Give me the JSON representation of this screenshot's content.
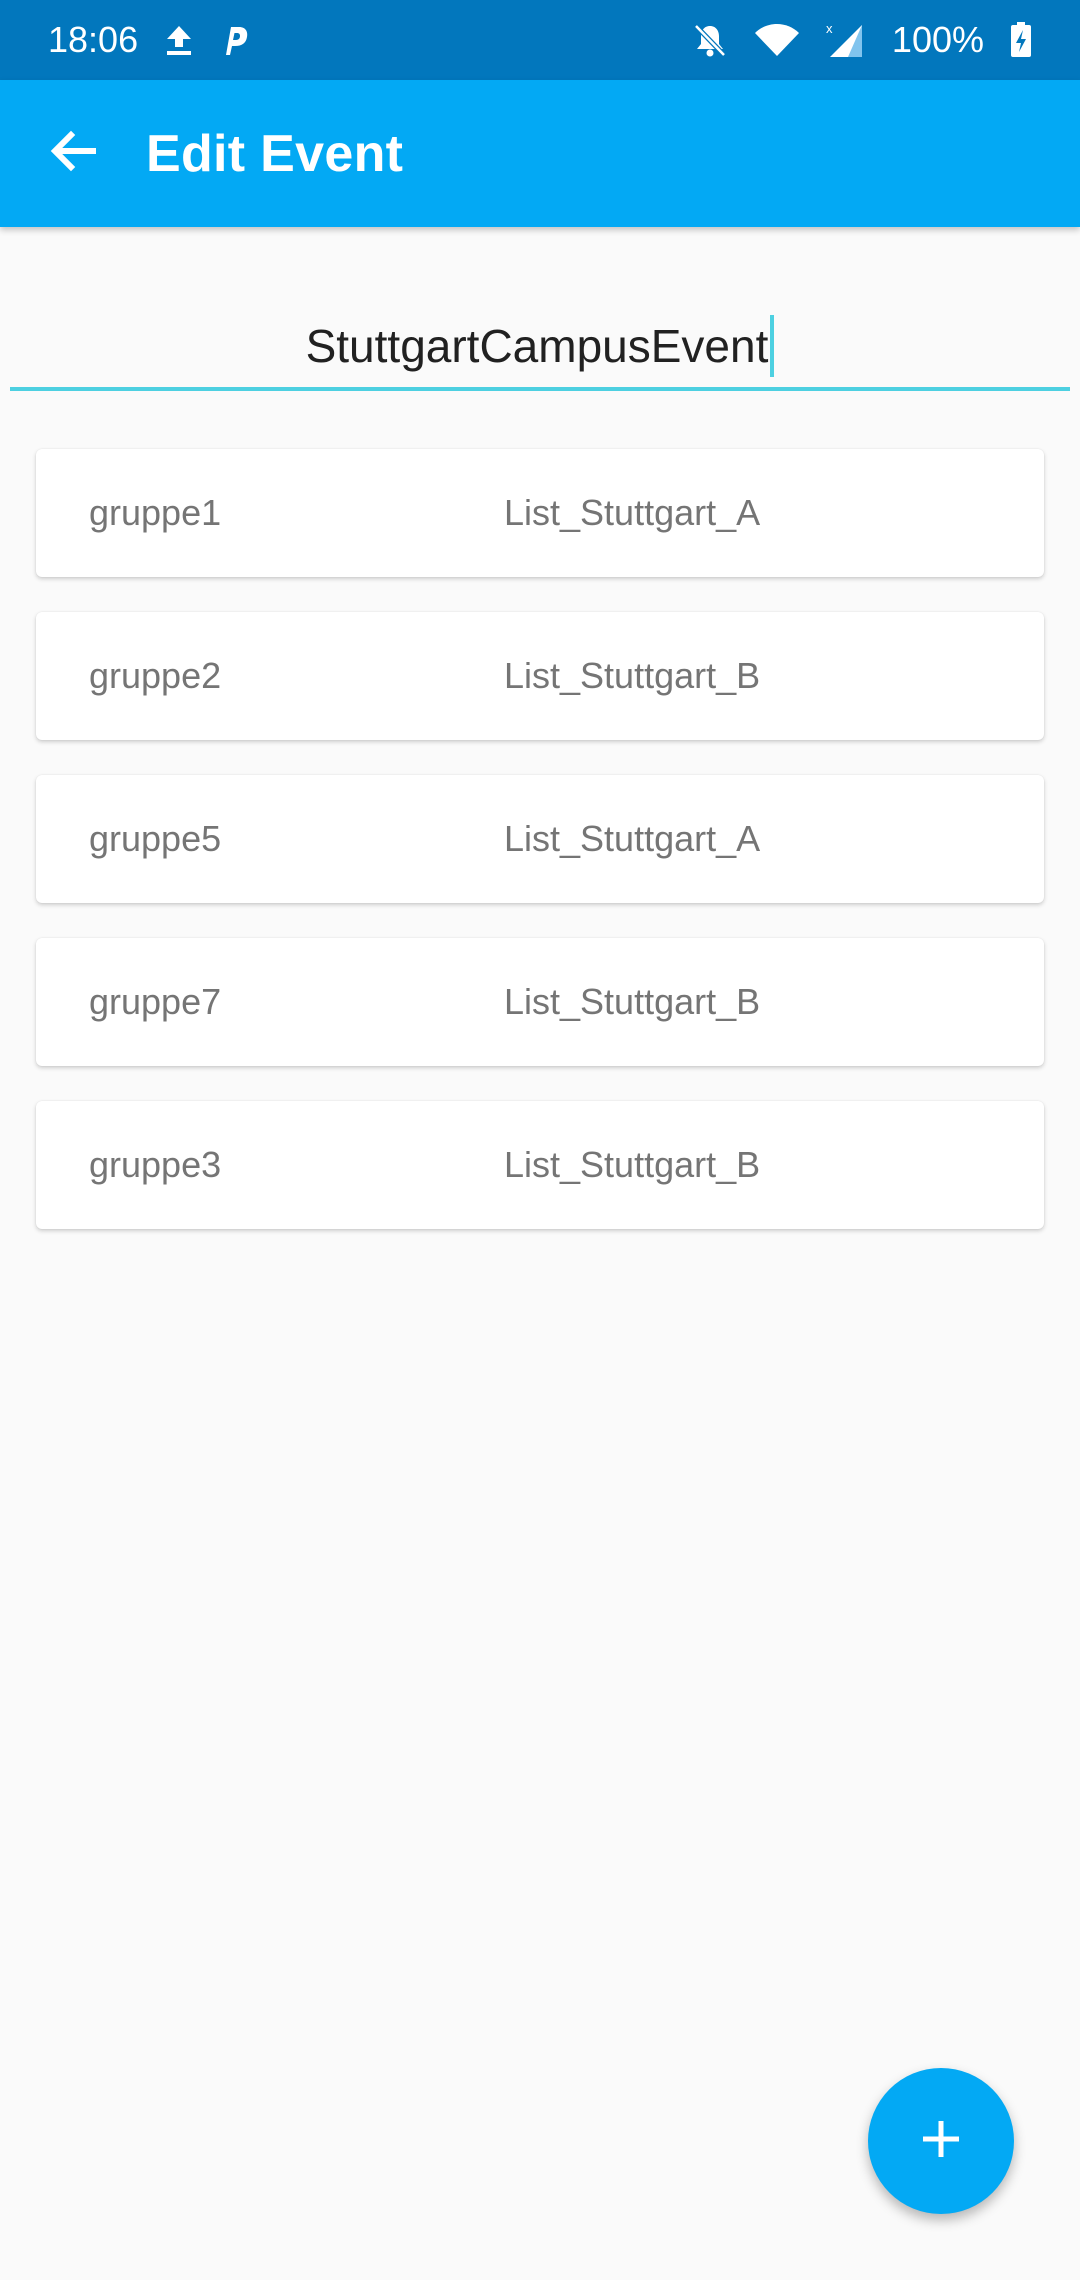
{
  "status_bar": {
    "time": "18:06",
    "battery": "100%",
    "icons": [
      "upload-icon",
      "parking-icon",
      "bell-off-icon",
      "wifi-icon",
      "signal-icon",
      "battery-charging-icon"
    ]
  },
  "app_bar": {
    "title": "Edit Event",
    "back_icon": "arrow-back-icon",
    "color": "#03a9f4"
  },
  "event_name": {
    "value": "StuttgartCampusEvent",
    "underline_color": "#4dd0e1"
  },
  "groups": [
    {
      "name": "gruppe1",
      "list": "List_Stuttgart_A"
    },
    {
      "name": "gruppe2",
      "list": "List_Stuttgart_B"
    },
    {
      "name": "gruppe5",
      "list": "List_Stuttgart_A"
    },
    {
      "name": "gruppe7",
      "list": "List_Stuttgart_B"
    },
    {
      "name": "gruppe3",
      "list": "List_Stuttgart_B"
    }
  ],
  "fab": {
    "icon": "plus-icon",
    "color": "#03a9f4"
  }
}
